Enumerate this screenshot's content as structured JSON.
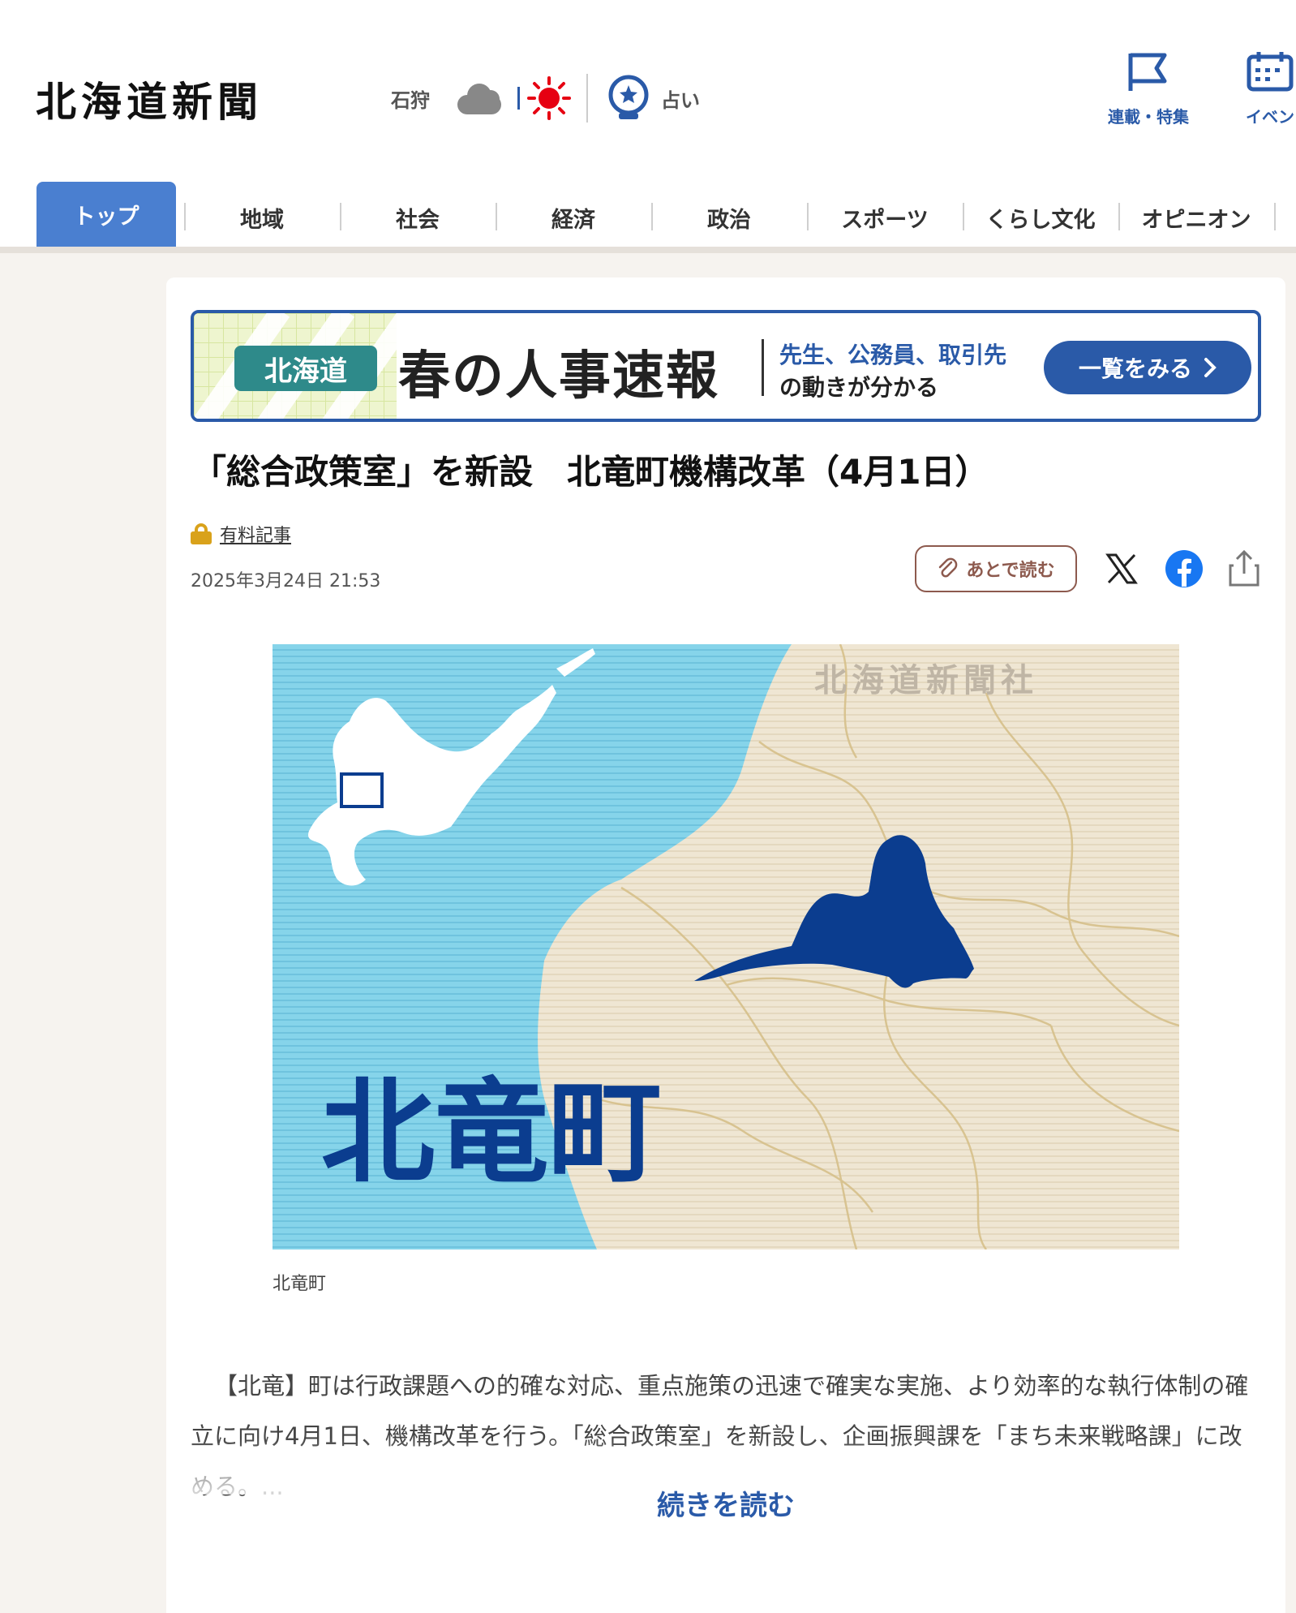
{
  "header": {
    "logo": "北海道新聞",
    "weather": {
      "location": "石狩",
      "icons": [
        "cloud-icon",
        "sun-icon"
      ]
    },
    "fortune_label": "占い",
    "links": [
      {
        "label": "連載・特集",
        "icon": "flag-icon"
      },
      {
        "label": "イベン",
        "icon": "calendar-icon"
      }
    ]
  },
  "nav": {
    "tabs": [
      "トップ",
      "地域",
      "社会",
      "経済",
      "政治",
      "スポーツ",
      "くらし文化",
      "オピニオン"
    ],
    "active": "トップ"
  },
  "banner": {
    "pill": "北海道",
    "headline": "春の人事速報",
    "sub1": "先生、公務員、取引先",
    "sub2": "の動きが分かる",
    "button": "一覧をみる"
  },
  "article": {
    "title": "「総合政策室」を新設　北竜町機構改革（4月1日）",
    "paid_label": "有料記事",
    "date": "2025年3月24日 21:53",
    "read_later": "あとで読む",
    "map_watermark": "北海道新聞社",
    "map_label": "北竜町",
    "caption": "北竜町",
    "body": "【北竜】町は行政課題への的確な対応、重点施策の迅速で確実な実施、より効率的な執行体制の確立に向け4月1日、機構改革を行う。「総合政策室」を新設し、企画振興課を「まち未来戦略課」に改める。...",
    "read_more": "続きを読む"
  },
  "colors": {
    "brand_blue": "#2a5aa8",
    "tab_active": "#4a7fd0",
    "sea": "#7fd3e8",
    "land": "#efe6d3",
    "town": "#0b3d8f"
  }
}
